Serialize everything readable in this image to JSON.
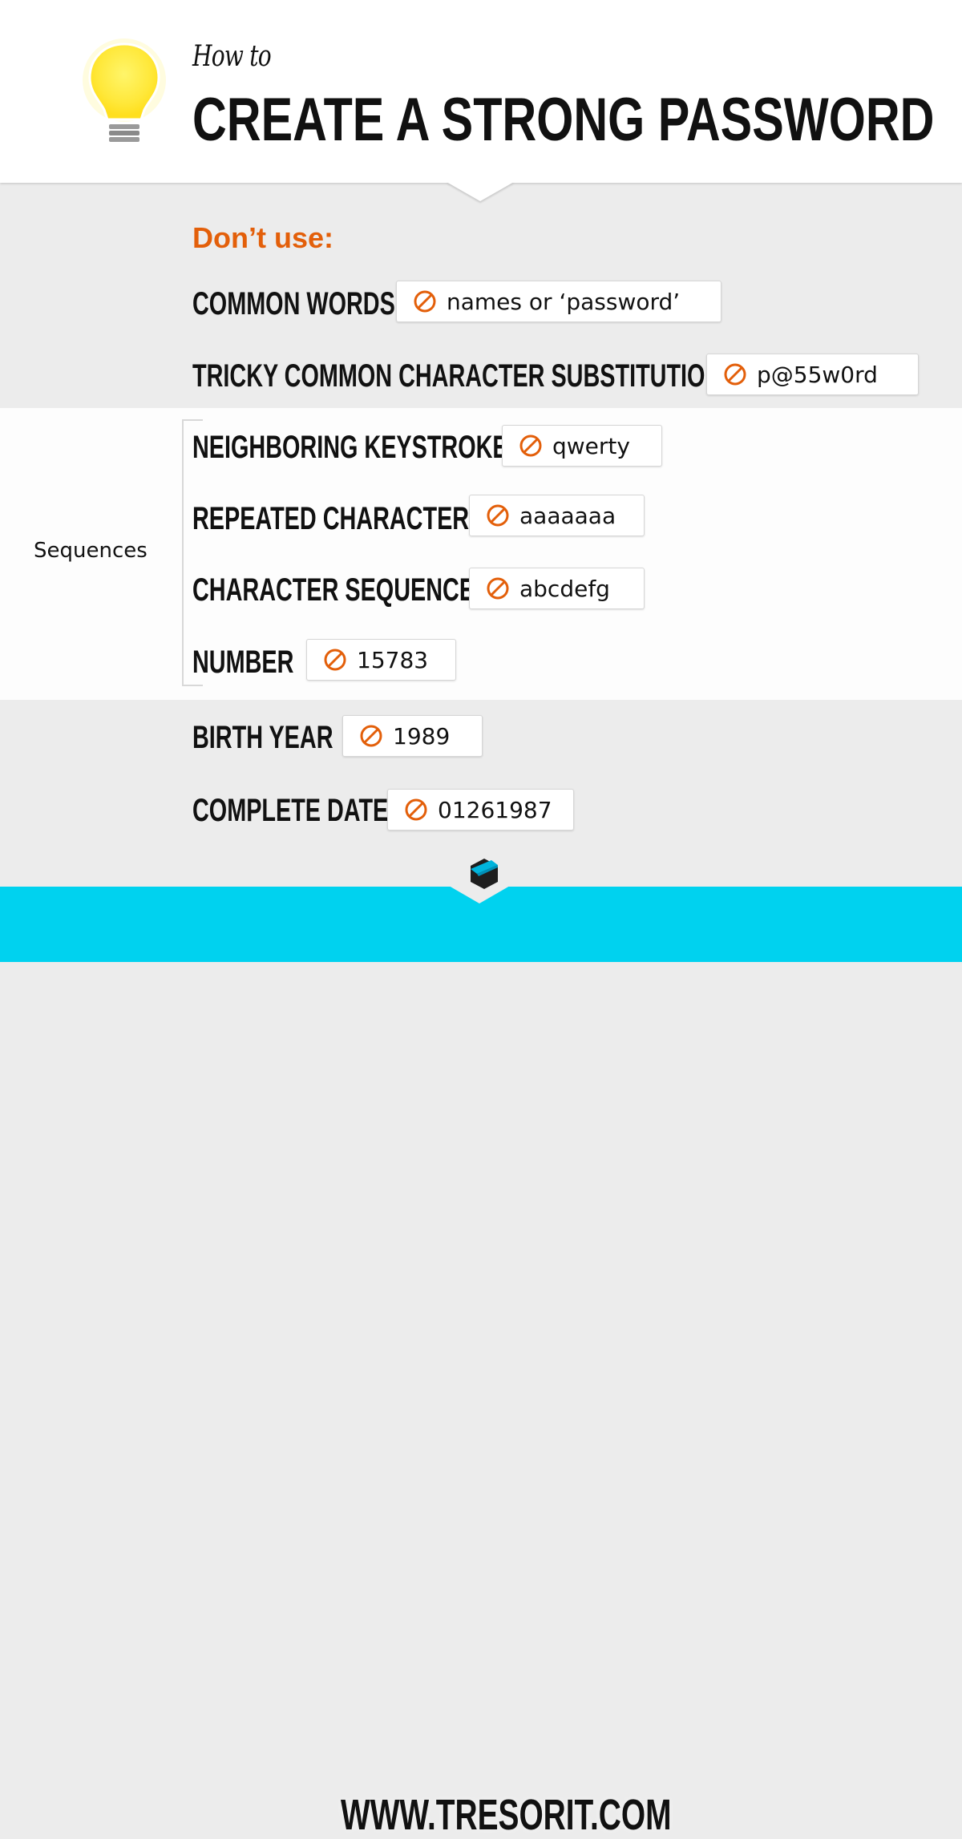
{
  "header": {
    "icon": "lightbulb-icon",
    "howto": "How to",
    "title": "CREATE A STRONG PASSWORD"
  },
  "section": {
    "heading": "Don’t use:",
    "heading_color": "#e35f0a",
    "group_label": "Sequences"
  },
  "items": [
    {
      "label": "COMMON WORDS",
      "example": "names or ‘password’",
      "icon": "ban-icon"
    },
    {
      "label": "TRICKY COMMON CHARACTER SUBSTITUTIONS",
      "example": "p@55w0rd",
      "icon": "ban-icon"
    },
    {
      "label": "NEIGHBORING KEYSTROKES",
      "example": "qwerty",
      "icon": "ban-icon"
    },
    {
      "label": "REPEATED CHARACTERS",
      "example": "aaaaaaa",
      "icon": "ban-icon"
    },
    {
      "label": "CHARACTER SEQUENCE",
      "example": "abcdefg",
      "icon": "ban-icon"
    },
    {
      "label": "NUMBER",
      "example": "15783",
      "icon": "ban-icon"
    },
    {
      "label": "BIRTH YEAR",
      "example": "1989",
      "icon": "ban-icon"
    },
    {
      "label": "COMPLETE DATE",
      "example": "01261987",
      "icon": "ban-icon"
    }
  ],
  "footer": {
    "logo": "tresorit-logo-icon",
    "url": "WWW.TRESORIT.COM",
    "color": "#00d2ef"
  }
}
